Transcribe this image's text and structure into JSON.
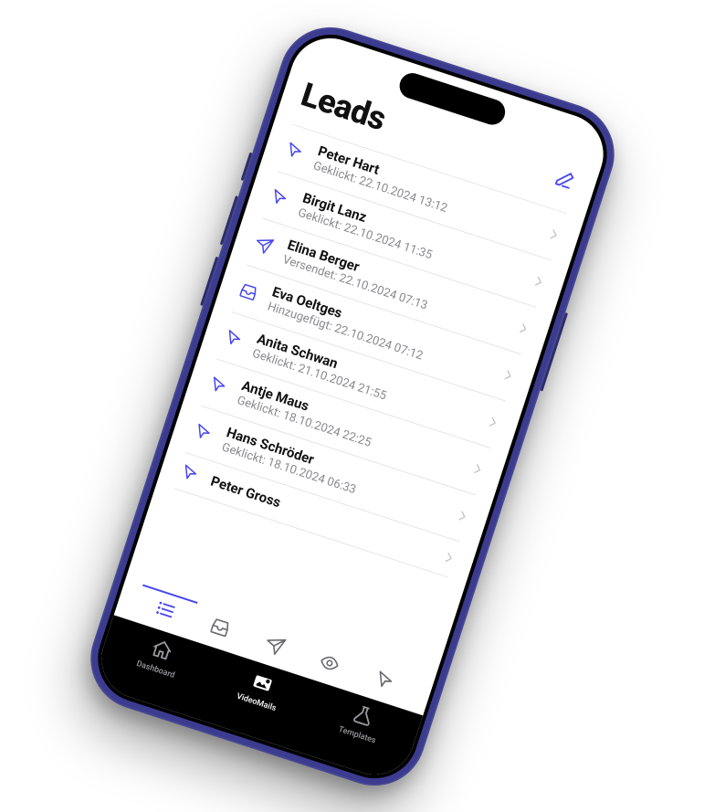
{
  "page_title": "Leads",
  "accent": "#4646f0",
  "leads": [
    {
      "icon": "cursor",
      "name": "Peter Hart",
      "status": "Geklickt: 22.10.2024 13:12"
    },
    {
      "icon": "cursor",
      "name": "Birgit Lanz",
      "status": "Geklickt: 22.10.2024 11:35"
    },
    {
      "icon": "send",
      "name": "Elina Berger",
      "status": "Versendet: 22.10.2024 07:13"
    },
    {
      "icon": "inbox",
      "name": "Eva Oeltges",
      "status": "Hinzugefügt: 22.10.2024 07:12"
    },
    {
      "icon": "cursor",
      "name": "Anita Schwan",
      "status": "Geklickt: 21.10.2024 21:55"
    },
    {
      "icon": "cursor",
      "name": "Antje Maus",
      "status": "Geklickt: 18.10.2024 22:25"
    },
    {
      "icon": "cursor",
      "name": "Hans Schröder",
      "status": "Geklickt: 18.10.2024 06:33"
    },
    {
      "icon": "cursor",
      "name": "Peter Gross",
      "status": ""
    }
  ],
  "filters": [
    {
      "icon": "list",
      "active": true
    },
    {
      "icon": "inbox",
      "active": false
    },
    {
      "icon": "send",
      "active": false
    },
    {
      "icon": "eye",
      "active": false
    },
    {
      "icon": "cursor",
      "active": false
    }
  ],
  "tabs": [
    {
      "icon": "home",
      "label": "Dashboard",
      "active": false
    },
    {
      "icon": "video",
      "label": "VideoMails",
      "active": true
    },
    {
      "icon": "flask",
      "label": "Templates",
      "active": false
    }
  ]
}
